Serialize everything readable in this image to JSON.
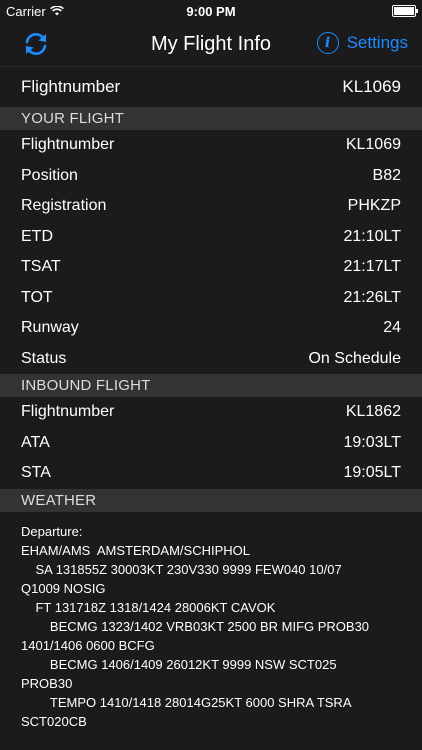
{
  "status_bar": {
    "carrier": "Carrier",
    "time": "9:00 PM"
  },
  "nav": {
    "title": "My Flight Info",
    "settings_label": "Settings"
  },
  "top": {
    "label": "Flightnumber",
    "value": "KL1069"
  },
  "your_flight": {
    "header": "YOUR FLIGHT",
    "rows": [
      {
        "label": "Flightnumber",
        "value": "KL1069"
      },
      {
        "label": "Position",
        "value": "B82"
      },
      {
        "label": "Registration",
        "value": "PHKZP"
      },
      {
        "label": "ETD",
        "value": "21:10LT"
      },
      {
        "label": "TSAT",
        "value": "21:17LT"
      },
      {
        "label": "TOT",
        "value": "21:26LT"
      },
      {
        "label": "Runway",
        "value": "24"
      },
      {
        "label": "Status",
        "value": "On Schedule"
      }
    ]
  },
  "inbound_flight": {
    "header": "INBOUND FLIGHT",
    "rows": [
      {
        "label": "Flightnumber",
        "value": "KL1862"
      },
      {
        "label": "ATA",
        "value": "19:03LT"
      },
      {
        "label": "STA",
        "value": "19:05LT"
      }
    ]
  },
  "weather": {
    "header": "WEATHER",
    "text": "Departure:\nEHAM/AMS  AMSTERDAM/SCHIPHOL\n    SA 131855Z 30003KT 230V330 9999 FEW040 10/07\nQ1009 NOSIG\n    FT 131718Z 1318/1424 28006KT CAVOK\n        BECMG 1323/1402 VRB03KT 2500 BR MIFG PROB30\n1401/1406 0600 BCFG\n        BECMG 1406/1409 26012KT 9999 NSW SCT025\nPROB30\n        TEMPO 1410/1418 28014G25KT 6000 SHRA TSRA\nSCT020CB"
  },
  "colors": {
    "accent": "#1e8cff",
    "background": "#1b1b1d",
    "section": "#333336"
  }
}
